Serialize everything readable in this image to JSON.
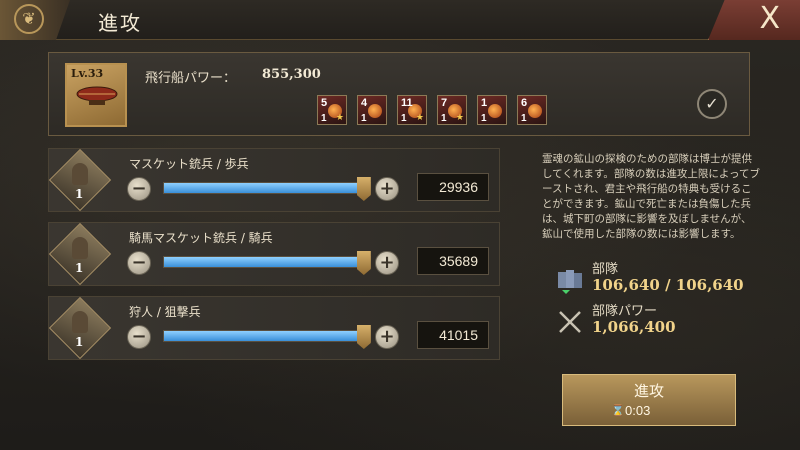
{
  "header": {
    "title": "進攻",
    "close_label": "X"
  },
  "airship": {
    "level": "Lv.33",
    "power_label": "飛行船パワー：",
    "power_value": "855,300",
    "slots": [
      {
        "top": "5",
        "bottom": "1"
      },
      {
        "top": "4",
        "bottom": "1"
      },
      {
        "top": "11",
        "bottom": "1"
      },
      {
        "top": "7",
        "bottom": "1"
      },
      {
        "top": "1",
        "bottom": "1"
      },
      {
        "top": "6",
        "bottom": "1"
      }
    ]
  },
  "troops": [
    {
      "name": "マスケット銃兵 / 歩兵",
      "tier": "1",
      "count": "29936",
      "fill": 0.97
    },
    {
      "name": "騎馬マスケット銃兵 / 騎兵",
      "tier": "1",
      "count": "35689",
      "fill": 0.97
    },
    {
      "name": "狩人 / 狙撃兵",
      "tier": "1",
      "count": "41015",
      "fill": 0.97
    }
  ],
  "info": {
    "description": "霊魂の鉱山の探検のための部隊は博士が提供してくれます。部隊の数は進攻上限によってブーストされ、君主や飛行船の特典も受けることができます。鉱山で死亡または負傷した兵は、城下町の部隊に影響を及ぼしませんが、鉱山で使用した部隊の数には影響します。"
  },
  "stats": {
    "troops_label": "部隊",
    "troops_value": "106,640 / 106,640",
    "power_label": "部隊パワー",
    "power_value": "1,066,400"
  },
  "attack": {
    "label": "進攻",
    "time": "0:03"
  }
}
